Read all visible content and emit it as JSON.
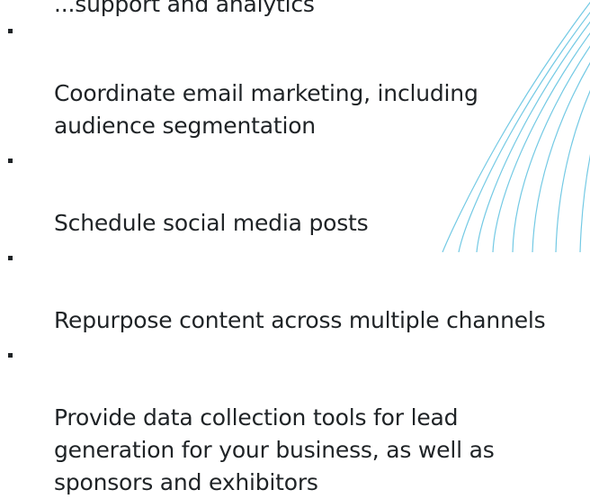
{
  "header_fragment": "...support and analytics",
  "bullets": [
    "Coordinate email marketing, including\naudience segmentation",
    "Schedule social media posts",
    "Repurpose content across multiple channels",
    "Provide data collection tools for lead\ngeneration for your business, as well as\nsponsors and exhibitors"
  ],
  "colors": {
    "text": "#1f2326",
    "accent_arcs": "#6cc7e3"
  }
}
